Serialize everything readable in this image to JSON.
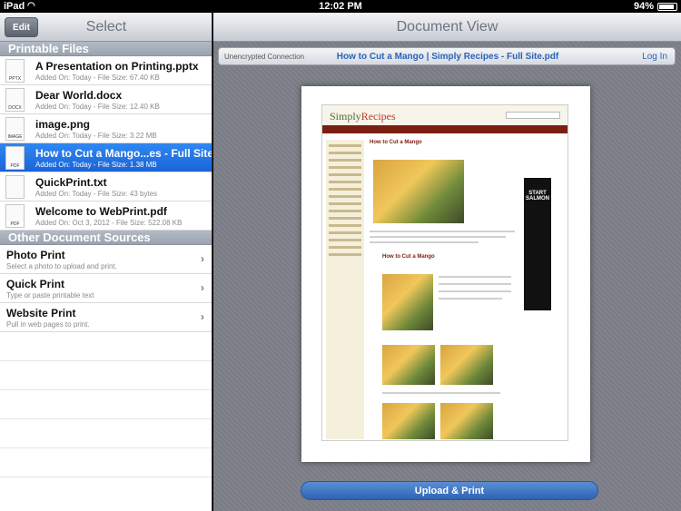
{
  "statusbar": {
    "carrier": "iPad",
    "time": "12:02 PM",
    "battery": "94%"
  },
  "left": {
    "edit_label": "Edit",
    "title": "Select",
    "printable_header": "Printable Files",
    "files": [
      {
        "name": "A Presentation on Printing.pptx",
        "meta": "Added On: Today - File Size: 67.40 KB",
        "icon": "pptx-file-icon",
        "tag": "PPTX",
        "selected": false
      },
      {
        "name": "Dear World.docx",
        "meta": "Added On: Today - File Size: 12.40 KB",
        "icon": "docx-file-icon",
        "tag": "DOCX",
        "selected": false
      },
      {
        "name": "image.png",
        "meta": "Added On: Today - File Size: 3.22 MB",
        "icon": "image-file-icon",
        "tag": "IMAGE",
        "selected": false
      },
      {
        "name": "How to Cut a Mango...es - Full Site.pdf",
        "meta": "Added On: Today - File Size: 1.38 MB",
        "icon": "pdf-file-icon",
        "tag": "PDF",
        "selected": true
      },
      {
        "name": "QuickPrint.txt",
        "meta": "Added On: Today - File Size: 43 bytes",
        "icon": "text-file-icon",
        "tag": "",
        "selected": false
      },
      {
        "name": "Welcome to WebPrint.pdf",
        "meta": "Added On: Oct 3, 2012 - File Size: 522.08 KB",
        "icon": "pdf-file-icon",
        "tag": "PDF",
        "selected": false
      }
    ],
    "sources_header": "Other Document Sources",
    "sources": [
      {
        "name": "Photo Print",
        "desc": "Select a photo to upload and print."
      },
      {
        "name": "Quick Print",
        "desc": "Type or paste printable text"
      },
      {
        "name": "Website Print",
        "desc": "Pull in web pages to print."
      }
    ]
  },
  "right": {
    "title": "Document View",
    "connection": "Unencrypted Connection",
    "doc_title": "How to Cut a Mango | Simply Recipes - Full Site.pdf",
    "login": "Log In",
    "upload_label": "Upload & Print",
    "preview": {
      "logo_a": "Simply",
      "logo_b": "Recipes",
      "nav": [
        "Home",
        "About",
        "Recipe Index",
        "Subscribe",
        "Recipe Box"
      ],
      "article_title": "How to Cut a Mango",
      "ad_text": "START SALMON"
    }
  }
}
